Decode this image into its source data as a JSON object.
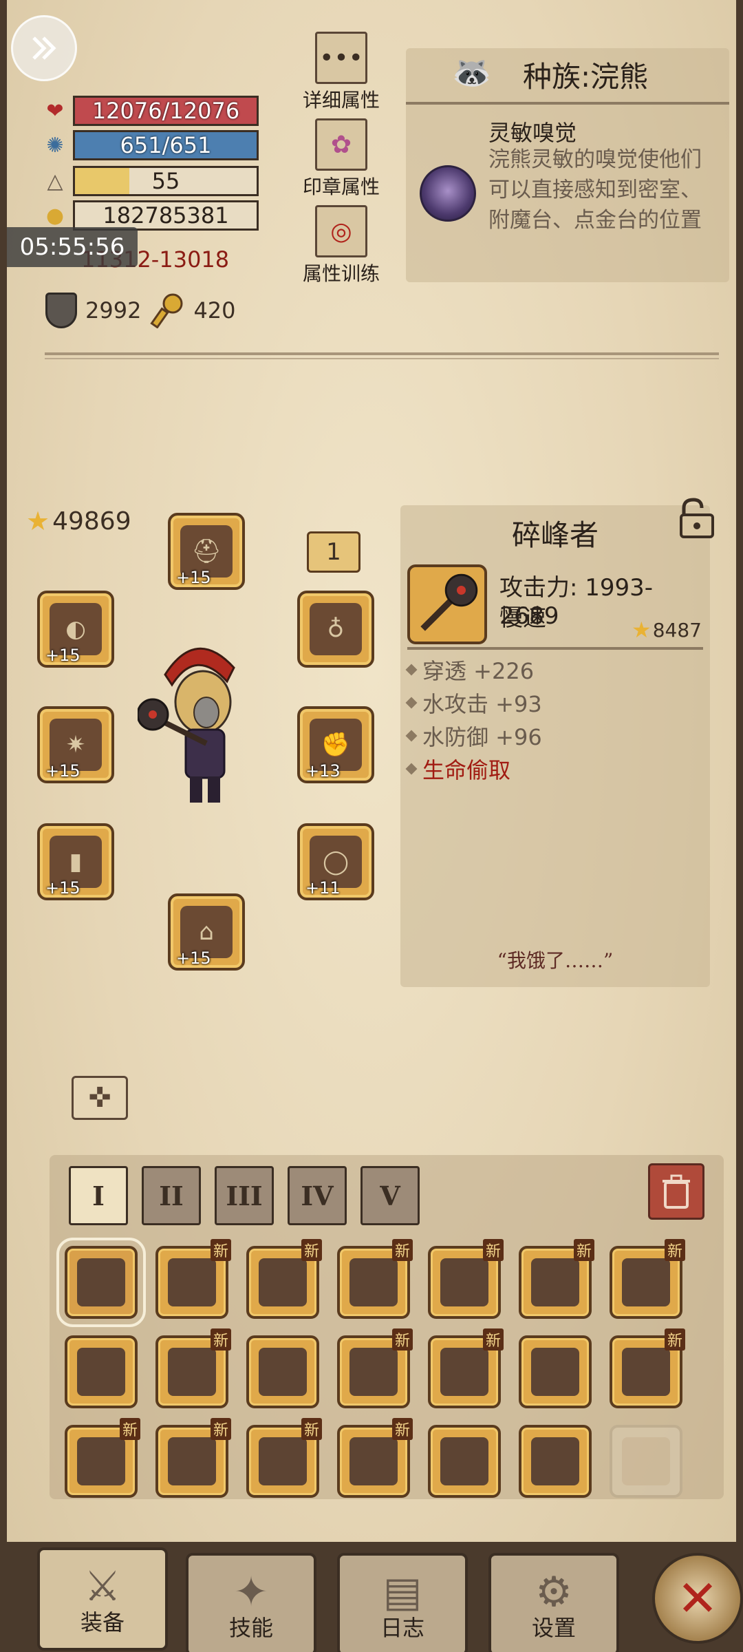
{
  "header": {
    "hp": {
      "text": "12076/12076",
      "fill_pct": 100,
      "color": "#c04a4e"
    },
    "mp": {
      "text": "651/651",
      "fill_pct": 100,
      "color": "#4d7fb0"
    },
    "level": {
      "text": "55",
      "fill_pct": 30,
      "color": "#e8c86a"
    },
    "exp": {
      "text": "182785381",
      "fill_pct": 0,
      "color": "#e8dcc3"
    },
    "attack_range": "11312-13018",
    "defense": "2992",
    "keys": "420",
    "time_overlay": "05:55:56"
  },
  "side_buttons": {
    "detail": "详细属性",
    "seal": "印章属性",
    "training": "属性训练"
  },
  "race": {
    "title": "种族:浣熊",
    "trait_name": "灵敏嗅觉",
    "trait_desc": "浣熊灵敏的嗅觉使他们可以直接感知到密室、附魔台、点金台的位置"
  },
  "equipment": {
    "total_score": "49869",
    "tier": "1",
    "slots": [
      {
        "name": "head",
        "plus": "+15",
        "icon": "helmet"
      },
      {
        "name": "shoulder",
        "plus": "+15",
        "icon": "pauldron"
      },
      {
        "name": "amulet",
        "plus": "",
        "icon": "amulet"
      },
      {
        "name": "weapon",
        "plus": "+15",
        "icon": "mace"
      },
      {
        "name": "gloves",
        "plus": "+13",
        "icon": "gauntlet"
      },
      {
        "name": "bracer",
        "plus": "+15",
        "icon": "bracer"
      },
      {
        "name": "ring",
        "plus": "+11",
        "icon": "ring"
      },
      {
        "name": "boots",
        "plus": "+15",
        "icon": "boots"
      }
    ]
  },
  "weapon": {
    "name": "碎峰者",
    "attack": "攻击力: 1993-2689",
    "speed": "慢速",
    "score": "8487",
    "affixes": [
      {
        "text": "穿透 +226",
        "red": false
      },
      {
        "text": "水攻击 +93",
        "red": false
      },
      {
        "text": "水防御 +96",
        "red": false
      },
      {
        "text": "生命偷取",
        "red": true
      }
    ],
    "quote": "“我饿了……”"
  },
  "inventory": {
    "tabs": [
      "I",
      "II",
      "III",
      "IV",
      "V"
    ],
    "active_tab": 0,
    "new_label": "新",
    "rows": [
      [
        {
          "new": false,
          "selected": true
        },
        {
          "new": true
        },
        {
          "new": true
        },
        {
          "new": true
        },
        {
          "new": true
        },
        {
          "new": true
        },
        {
          "new": true
        }
      ],
      [
        {
          "new": false
        },
        {
          "new": true
        },
        {
          "new": false
        },
        {
          "new": true
        },
        {
          "new": true
        },
        {
          "new": false
        },
        {
          "new": true
        }
      ],
      [
        {
          "new": true
        },
        {
          "new": true
        },
        {
          "new": true
        },
        {
          "new": true
        },
        {
          "new": false
        },
        {
          "new": false
        },
        {
          "new": false,
          "empty": true
        }
      ]
    ]
  },
  "nav": {
    "equipment": "装备",
    "skills": "技能",
    "log": "日志",
    "settings": "设置"
  }
}
